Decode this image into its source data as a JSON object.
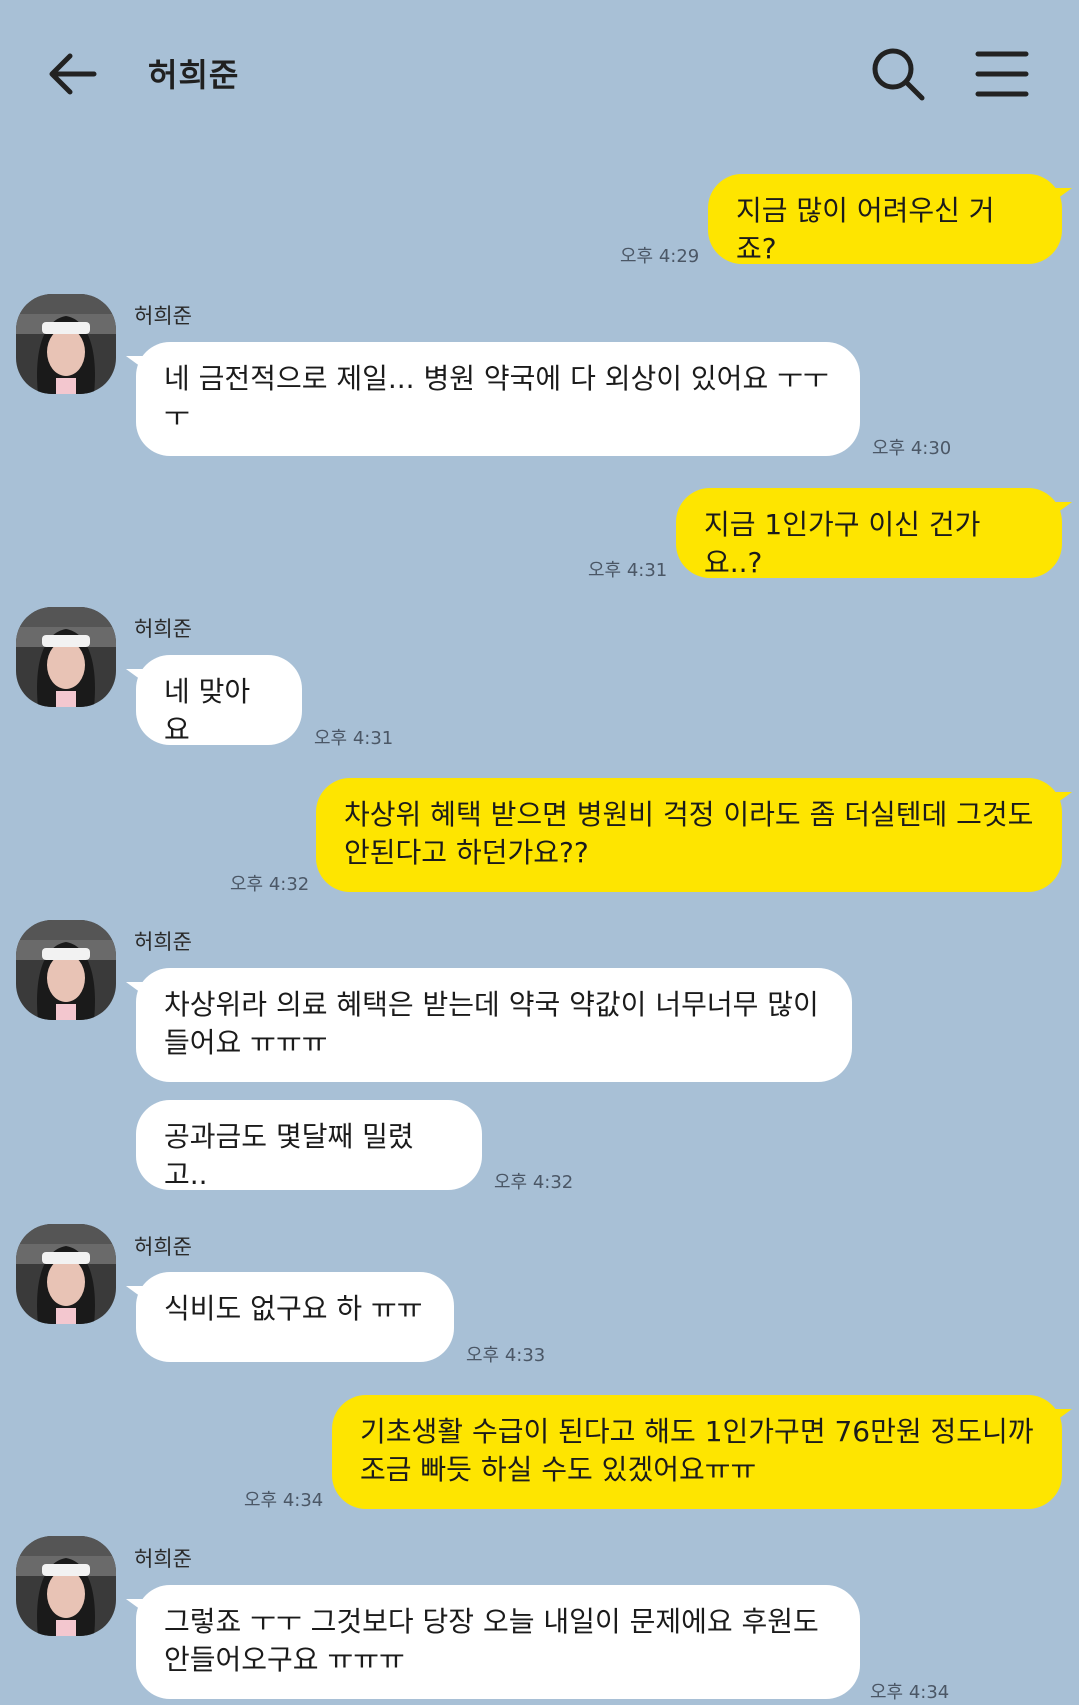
{
  "header": {
    "title": "허희준"
  },
  "colors": {
    "background": "#a8c0d6",
    "my_bubble": "#fee500",
    "their_bubble": "#ffffff"
  },
  "icons": {
    "back": "arrow-left-icon",
    "search": "search-icon",
    "menu": "hamburger-menu-icon"
  },
  "messages": [
    {
      "from": "me",
      "text": "지금 많이 어려우신 거죠?",
      "time": "오후 4:29"
    },
    {
      "from": "them",
      "sender": "허희준",
      "text": "네 금전적으로 제일... 병원 약국에 다 외상이 있어요 ㅜㅜ ㅜ",
      "time": "오후 4:30"
    },
    {
      "from": "me",
      "text": "지금 1인가구 이신 건가요..?",
      "time": "오후 4:31"
    },
    {
      "from": "them",
      "sender": "허희준",
      "text": "네 맞아요",
      "time": "오후 4:31"
    },
    {
      "from": "me",
      "text": "차상위 혜택 받으면 병원비 걱정 이라도 좀 더실텐데 그것도 안된다고 하던가요??",
      "time": "오후 4:32"
    },
    {
      "from": "them",
      "sender": "허희준",
      "text": "차상위라 의료 혜택은 받는데 약국 약값이 너무너무 많이 들어요 ㅠㅠㅠ"
    },
    {
      "from": "them",
      "text": "공과금도 몇달째 밀렸고..",
      "time": "오후 4:32"
    },
    {
      "from": "them",
      "sender": "허희준",
      "text": "식비도 없구요 하 ㅠㅠ",
      "time": "오후 4:33"
    },
    {
      "from": "me",
      "text": "기초생활 수급이 된다고 해도 1인가구면 76만원 정도니까 조금 빠듯 하실 수도 있겠어요ㅠㅠ",
      "time": "오후 4:34"
    },
    {
      "from": "them",
      "sender": "허희준",
      "text": "그렇죠 ㅜㅜ 그것보다 당장 오늘 내일이 문제에요 후원도 안들어오구요 ㅠㅠㅠ",
      "time": "오후 4:34"
    }
  ]
}
